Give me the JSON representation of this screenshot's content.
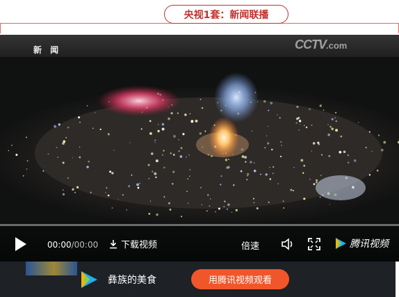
{
  "header": {
    "title": "央视1套：新闻联播"
  },
  "video": {
    "channel_label": "新 闻",
    "watermark": "CCTV",
    "watermark_suffix": ".com",
    "progress": 0.0
  },
  "controls": {
    "current_time": "00:00",
    "separator": "/",
    "duration": "00:00",
    "download_label": "下载视频",
    "speed_label": "倍速",
    "player_brand": "腾讯视频",
    "icons": [
      "play-icon",
      "download-icon",
      "volume-icon",
      "fullscreen-icon",
      "tencent-video-logo-icon"
    ]
  },
  "bottom_bar": {
    "video_title": "彝族的美食",
    "open_app_label": "用腾讯视频观看",
    "colors": {
      "button": "#f0562a",
      "bar": "#1e2126"
    }
  }
}
